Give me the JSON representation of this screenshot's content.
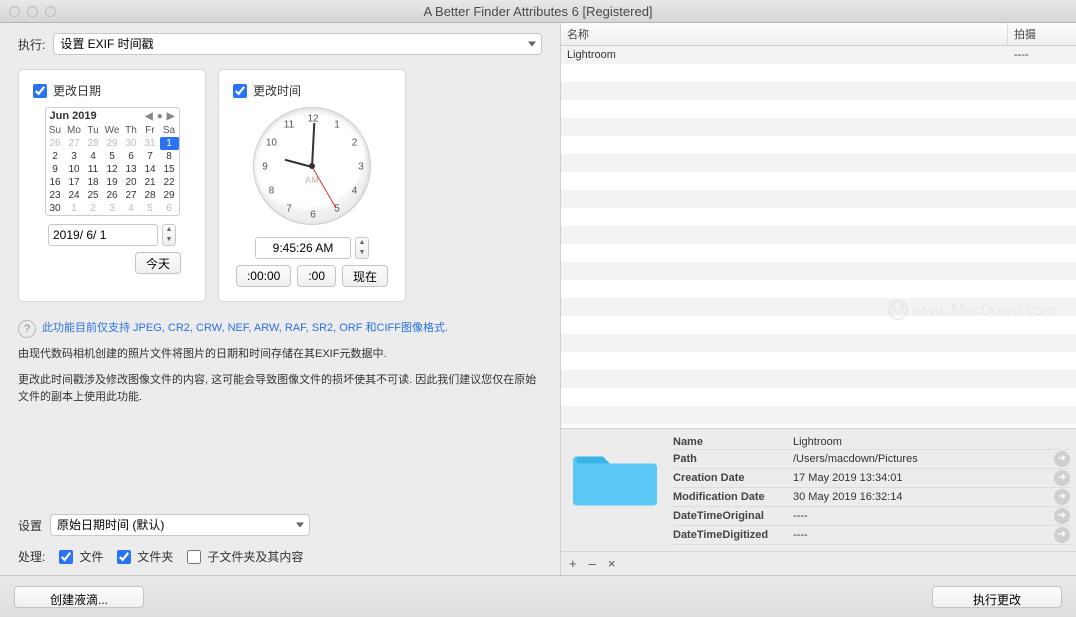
{
  "window": {
    "title": "A Better Finder Attributes 6 [Registered]"
  },
  "exec": {
    "label": "执行:",
    "action": "设置 EXIF 时间戳"
  },
  "datePanel": {
    "checkbox": "更改日期",
    "month": "Jun 2019",
    "weekdays": [
      "Su",
      "Mo",
      "Tu",
      "We",
      "Th",
      "Fr",
      "Sa"
    ],
    "prevTail": [
      "26",
      "27",
      "28",
      "29",
      "30",
      "31"
    ],
    "days": [
      "1",
      "2",
      "3",
      "4",
      "5",
      "6",
      "7",
      "8",
      "9",
      "10",
      "11",
      "12",
      "13",
      "14",
      "15",
      "16",
      "17",
      "18",
      "19",
      "20",
      "21",
      "22",
      "23",
      "24",
      "25",
      "26",
      "27",
      "28",
      "29",
      "30"
    ],
    "nextHead": [
      "1",
      "2",
      "3",
      "4",
      "5",
      "6"
    ],
    "selected": "1",
    "dateField": "2019/ 6/ 1",
    "todayBtn": "今天"
  },
  "timePanel": {
    "checkbox": "更改时间",
    "ampm": "AM",
    "timeField": "9:45:26 AM",
    "btnZero": ":00:00",
    "btnZeroMin": ":00",
    "btnNow": "现在",
    "numbers": [
      "12",
      "1",
      "2",
      "3",
      "4",
      "5",
      "6",
      "7",
      "8",
      "9",
      "10",
      "11"
    ]
  },
  "info": {
    "supported": "此功能目前仅支持 JPEG, CR2, CRW, NEF, ARW, RAF, SR2, ORF 和CIFF图像格式.",
    "p1": "由现代数码相机创建的照片文件将图片的日期和时间存储在其EXIF元数据中.",
    "p2": "更改此时间戳涉及修改图像文件的内容, 这可能会导致图像文件的损坏使其不可读. 因此我们建议您仅在原始文件的副本上使用此功能."
  },
  "settings": {
    "label": "设置",
    "value": "原始日期时间 (默认)"
  },
  "process": {
    "label": "处理:",
    "files": "文件",
    "folders": "文件夹",
    "sub": "子文件夹及其内容"
  },
  "table": {
    "colName": "名称",
    "colShot": "拍摄",
    "rows": [
      {
        "name": "Lightroom",
        "shot": "----"
      }
    ],
    "blankRows": 21
  },
  "detail": {
    "keys": {
      "name": "Name",
      "path": "Path",
      "cdate": "Creation Date",
      "mdate": "Modification Date",
      "dto": "DateTimeOriginal",
      "dtd": "DateTimeDigitized"
    },
    "vals": {
      "name": "Lightroom",
      "path": "/Users/macdown/Pictures",
      "cdate": "17 May 2019 13:34:01",
      "mdate": "30 May 2019 16:32:14",
      "dto": "----",
      "dtd": "----"
    }
  },
  "listToolbar": {
    "add": "+",
    "remove": "–",
    "clear": "×"
  },
  "bottom": {
    "droplet": "创建液滴...",
    "apply": "执行更改"
  },
  "watermark": "www.MacDown.com"
}
